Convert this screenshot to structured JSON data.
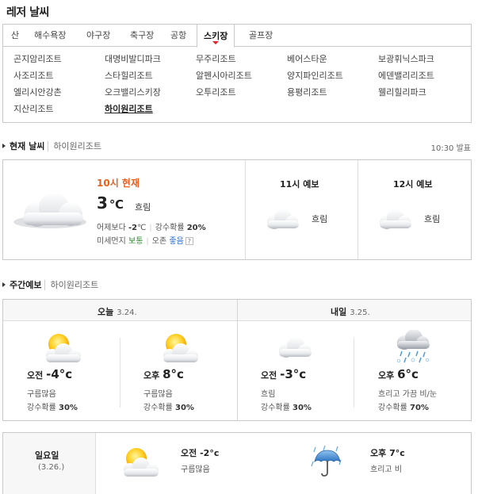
{
  "page_title": "레저 날씨",
  "tabs": [
    {
      "label": "산",
      "active": false
    },
    {
      "label": "해수욕장",
      "active": false
    },
    {
      "label": "야구장",
      "active": false
    },
    {
      "label": "축구장",
      "active": false
    },
    {
      "label": "공항",
      "active": false
    },
    {
      "label": "스키장",
      "active": true
    },
    {
      "label": "골프장",
      "active": false
    }
  ],
  "resorts": [
    "곤지암리조트",
    "대명비발디파크",
    "무주리조트",
    "베어스타운",
    "보광휘닉스파크",
    "사조리조트",
    "스타힐리조트",
    "알펜시아리조트",
    "양지파인리조트",
    "에덴밸리리조트",
    "엘리시안강촌",
    "오크밸리스키장",
    "오투리조트",
    "용평리조트",
    "웰리힐리파크",
    "지산리조트",
    "하이원리조트"
  ],
  "selected_resort": "하이원리조트",
  "current": {
    "section_title": "현재 날씨",
    "location": "하이원리조트",
    "issued": "10:30 발표",
    "hour_label": "10시 현재",
    "temp": "3",
    "unit": "℃",
    "condition": "흐림",
    "yesterday_label": "어제보다",
    "yesterday_value": "-2",
    "yesterday_unit": "℃",
    "rain_label": "강수확률",
    "rain_value": "20%",
    "dust_label": "미세먼지",
    "dust_value": "보통",
    "ozone_label": "오존",
    "ozone_value": "좋음",
    "help": "?"
  },
  "hourly": [
    {
      "title": "11시 예보",
      "condition": "흐림"
    },
    {
      "title": "12시 예보",
      "condition": "흐림"
    }
  ],
  "weekly": {
    "section_title": "주간예보",
    "location": "하이원리조트",
    "days": [
      {
        "label": "오늘",
        "date": "3.24.",
        "am": {
          "period": "오전",
          "temp": "-4",
          "unit": "°c",
          "condition": "구름많음",
          "rain_label": "강수확률",
          "rain": "30%",
          "icon": "sun-cloud"
        },
        "pm": {
          "period": "오후",
          "temp": "8",
          "unit": "°c",
          "condition": "구름많음",
          "rain_label": "강수확률",
          "rain": "30%",
          "icon": "sun-cloud"
        }
      },
      {
        "label": "내일",
        "date": "3.25.",
        "am": {
          "period": "오전",
          "temp": "-3",
          "unit": "°c",
          "condition": "흐림",
          "rain_label": "강수확률",
          "rain": "30%",
          "icon": "cloud"
        },
        "pm": {
          "period": "오후",
          "temp": "6",
          "unit": "°c",
          "condition": "흐리고 가끔 비/눈",
          "rain_label": "강수확률",
          "rain": "70%",
          "icon": "rain-snow"
        }
      }
    ]
  },
  "sunday": {
    "label": "일요일",
    "date": "(3.26.)",
    "am": {
      "period": "오전",
      "temp": "-2",
      "unit": "°c",
      "condition": "구름많음",
      "icon": "sun-cloud"
    },
    "pm": {
      "period": "오후",
      "temp": "7",
      "unit": "°c",
      "condition": "흐리고 비",
      "icon": "umbrella-rain"
    }
  },
  "colors": {
    "accent": "#e8601c",
    "tab_caret": "#e0222e",
    "dust_good": "#2e8b2e",
    "ozone_good": "#2b6ed1"
  }
}
